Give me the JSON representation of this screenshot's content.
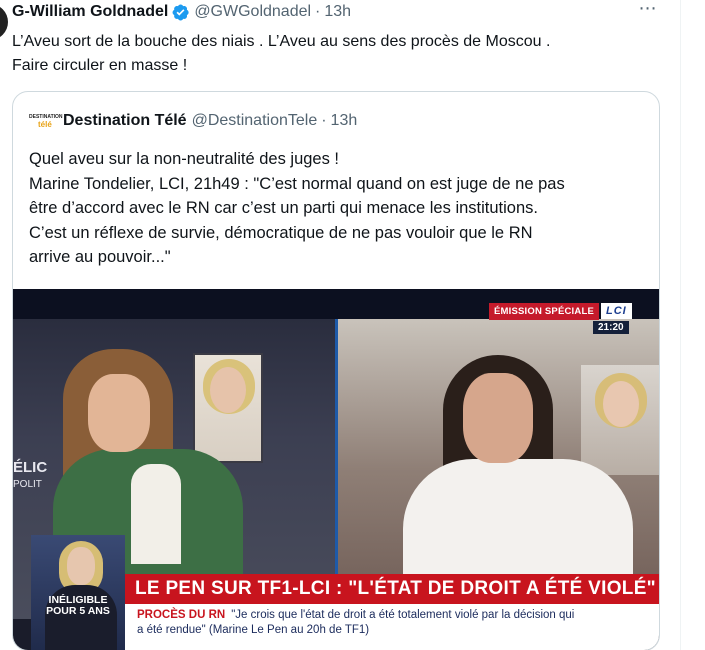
{
  "tweet": {
    "author_name": "G-William Goldnadel",
    "handle": "@GWGoldnadel",
    "separator": "·",
    "time": "13h",
    "more_icon": "⋯",
    "text_line1": "L’Aveu sort de la bouche des niais . L’Aveu au sens des procès de Moscou .",
    "text_line2": "Faire circuler en masse !"
  },
  "quote": {
    "logo_top": "DESTINATION",
    "logo_bottom": "télé",
    "author_name": "Destination Télé",
    "handle": "@DestinationTele",
    "separator": "·",
    "time": "13h",
    "text_lines": [
      "Quel aveu sur la non-neutralité des juges !",
      "Marine Tondelier, LCI, 21h49 : \"C’est normal quand on est juge de ne pas",
      "être d’accord avec le RN car c’est un parti qui menace les institutions.",
      "C’est un réflexe de survie, démocratique de ne pas vouloir que le RN",
      "arrive au pouvoir...\""
    ]
  },
  "media": {
    "emission_tag": "ÉMISSION SPÉCIALE",
    "channel_logo": "LCI",
    "clock": "21:20",
    "left_label_top": "ÉLIC",
    "left_label_bottom": "POLIT",
    "ineligible_line1": "INÉLIGIBLE",
    "ineligible_line2": "POUR 5 ANS",
    "banner": "LE PEN SUR TF1-LCI : \"L'ÉTAT DE DROIT A ÉTÉ VIOLÉ\"",
    "lower_label": "PROCÈS DU RN",
    "lower_quote_1": "\"Je crois que l'état de droit a été totalement violé par la décision qui",
    "lower_quote_2": "a été rendue\" (Marine Le Pen au 20h de TF1)"
  },
  "colors": {
    "text": "#0f1419",
    "secondary": "#536471",
    "verified": "#1d9bf0",
    "border": "#cfd9de",
    "lci_red": "#c8141e"
  }
}
